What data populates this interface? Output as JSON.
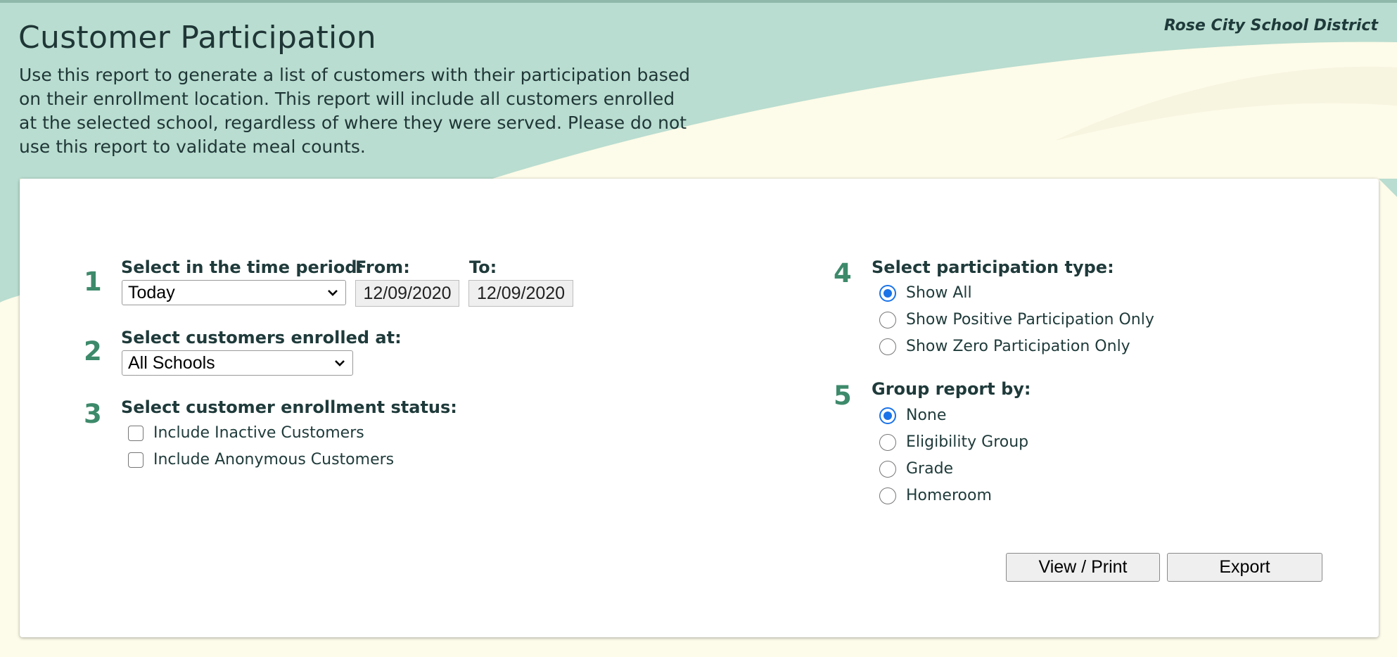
{
  "header": {
    "district": "Rose City School District",
    "title": "Customer Participation",
    "description": "Use this report to generate a list of customers with their participation based on their enrollment location. This report will include all customers enrolled at the selected school, regardless of where they were served. Please do not use this report to validate meal counts."
  },
  "steps": {
    "step1": {
      "number": "1",
      "label": "Select in the time period:",
      "period_value": "Today",
      "from_label": "From:",
      "from_value": "12/09/2020",
      "to_label": "To:",
      "to_value": "12/09/2020"
    },
    "step2": {
      "number": "2",
      "label": "Select customers enrolled at:",
      "school_value": "All Schools"
    },
    "step3": {
      "number": "3",
      "label": "Select customer enrollment status:",
      "options": [
        "Include Inactive Customers",
        "Include Anonymous Customers"
      ],
      "checked": [
        false,
        false
      ]
    },
    "step4": {
      "number": "4",
      "label": "Select participation type:",
      "options": [
        "Show All",
        "Show Positive Participation Only",
        "Show Zero Participation Only"
      ],
      "selected": "Show All"
    },
    "step5": {
      "number": "5",
      "label": "Group report by:",
      "options": [
        "None",
        "Eligibility Group",
        "Grade",
        "Homeroom"
      ],
      "selected": "None"
    }
  },
  "actions": {
    "view_print": "View / Print",
    "export": "Export"
  },
  "colors": {
    "header_band": "#b9ddd0",
    "page_background": "#fdfbe9",
    "step_number": "#3d8a6b",
    "radio_accent": "#1a73e8"
  }
}
